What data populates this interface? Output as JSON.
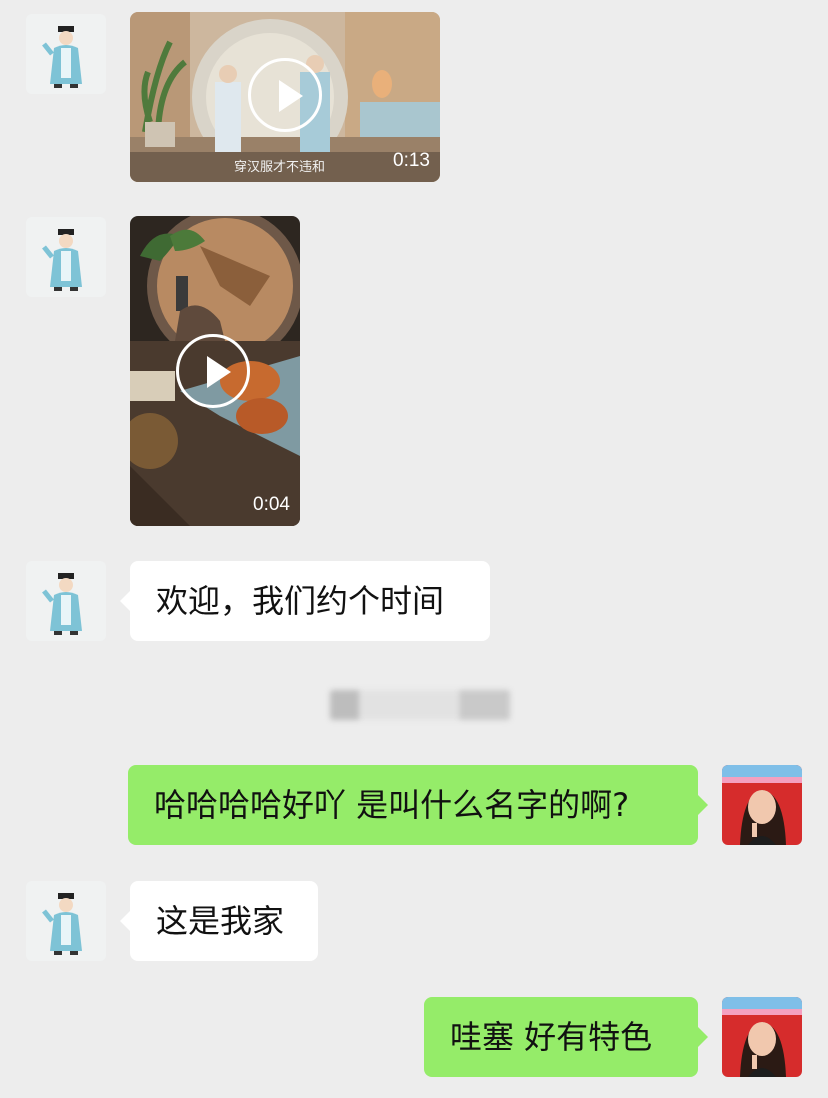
{
  "messages": [
    {
      "video_duration": "0:13",
      "video_caption": "穿汉服才不违和"
    },
    {
      "video_duration": "0:04"
    },
    {
      "text": "欢迎，我们约个时间"
    },
    {
      "text": "哈哈哈哈好吖  是叫什么名字的啊?"
    },
    {
      "text": "这是我家"
    },
    {
      "text": "哇塞  好有特色"
    }
  ],
  "icons": {
    "play": "play-icon"
  },
  "colors": {
    "background": "#ededed",
    "incoming_bubble": "#ffffff",
    "outgoing_bubble": "#95ec69"
  }
}
